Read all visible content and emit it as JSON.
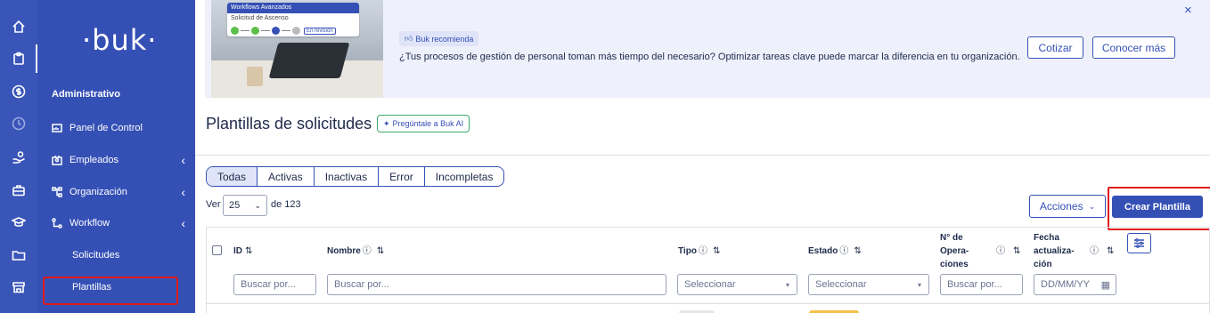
{
  "rail": {
    "icons": [
      "home-icon",
      "clipboard-icon",
      "dollar-icon",
      "clock-icon",
      "hand-coin-icon",
      "briefcase-icon",
      "graduation-cap-icon",
      "folder-icon",
      "store-icon"
    ]
  },
  "sidebar": {
    "logo": "·buk·",
    "section": "Administrativo",
    "items": [
      {
        "label": "Panel de Control",
        "icon": "dashboard-icon"
      },
      {
        "label": "Empleados",
        "icon": "employees-icon",
        "chevron": "‹"
      },
      {
        "label": "Organización",
        "icon": "org-chart-icon",
        "chevron": "‹"
      },
      {
        "label": "Workflow",
        "icon": "workflow-icon",
        "chevron": "‹"
      }
    ],
    "sub_items": [
      "Solicitudes",
      "Plantillas"
    ],
    "active_sub": "Plantillas"
  },
  "banner": {
    "card_title": "Workflows Avanzados",
    "card_subtitle": "Solicitud de Ascenso",
    "card_tag": "En revisión",
    "badge": "Buk recomienda",
    "text": "¿Tus procesos de gestión de personal toman más tiempo del necesario? Optimizar tareas clave puede marcar la diferencia en tu organización.",
    "btn_cotizar": "Cotizar",
    "btn_conocer": "Conocer más",
    "close": "×"
  },
  "page": {
    "title": "Plantillas de solicitudes",
    "ai_pill": "Pregúntale a Buk AI"
  },
  "tabs": [
    "Todas",
    "Activas",
    "Inactivas",
    "Error",
    "Incompletas"
  ],
  "active_tab": "Todas",
  "pagination": {
    "ver": "Ver",
    "per_page": "25",
    "de": "de 123"
  },
  "toolbar": {
    "acciones": "Acciones",
    "crear": "Crear Plantilla"
  },
  "table": {
    "headers": {
      "id": "ID",
      "nombre": "Nombre",
      "tipo": "Tipo",
      "estado": "Estado",
      "operaciones_1": "N° de",
      "operaciones_2": "Opera-",
      "operaciones_3": "ciones",
      "fecha_1": "Fecha",
      "fecha_2": "actualiza-",
      "fecha_3": "ción"
    },
    "filters": {
      "id": "Buscar por...",
      "nombre": "Buscar por...",
      "tipo": "Seleccionar",
      "estado": "Seleccionar",
      "operaciones": "Buscar por...",
      "fecha": "DD/MM/YY"
    }
  },
  "colors": {
    "brand": "#3550b5",
    "highlight": "#e01b1b"
  }
}
